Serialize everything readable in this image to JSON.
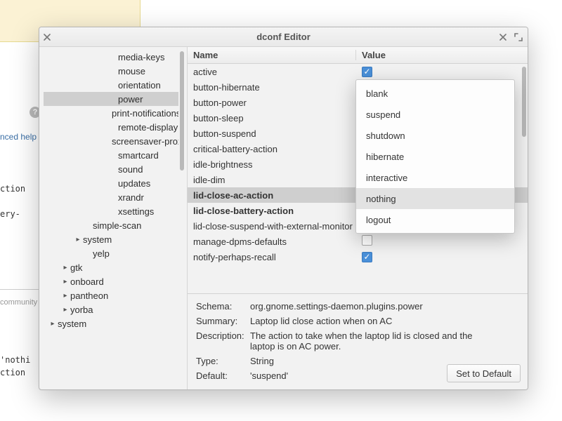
{
  "bg": {
    "link_text": "nced help »",
    "mono1": "ction",
    "mono2": "ery-",
    "mono3": "'nothi",
    "mono4": "ction",
    "community": "community"
  },
  "window": {
    "title": "dconf Editor"
  },
  "tree": [
    {
      "label": "media-keys",
      "indent": 86,
      "expander": false
    },
    {
      "label": "mouse",
      "indent": 86,
      "expander": false
    },
    {
      "label": "orientation",
      "indent": 86,
      "expander": false
    },
    {
      "label": "power",
      "indent": 86,
      "expander": false,
      "selected": true
    },
    {
      "label": "print-notifications",
      "indent": 86,
      "expander": false
    },
    {
      "label": "remote-display",
      "indent": 86,
      "expander": false
    },
    {
      "label": "screensaver-proxy",
      "indent": 86,
      "expander": false
    },
    {
      "label": "smartcard",
      "indent": 86,
      "expander": false
    },
    {
      "label": "sound",
      "indent": 86,
      "expander": false
    },
    {
      "label": "updates",
      "indent": 86,
      "expander": false
    },
    {
      "label": "xrandr",
      "indent": 86,
      "expander": false
    },
    {
      "label": "xsettings",
      "indent": 86,
      "expander": false
    },
    {
      "label": "simple-scan",
      "indent": 50,
      "expander": false
    },
    {
      "label": "system",
      "indent": 36,
      "expander": true
    },
    {
      "label": "yelp",
      "indent": 50,
      "expander": false
    },
    {
      "label": "gtk",
      "indent": 18,
      "expander": true
    },
    {
      "label": "onboard",
      "indent": 18,
      "expander": true
    },
    {
      "label": "pantheon",
      "indent": 18,
      "expander": true
    },
    {
      "label": "yorba",
      "indent": 18,
      "expander": true
    },
    {
      "label": "system",
      "indent": 0,
      "expander": true
    }
  ],
  "table": {
    "header_name": "Name",
    "header_value": "Value",
    "rows": [
      {
        "name": "active",
        "type": "check",
        "checked": true
      },
      {
        "name": "button-hibernate",
        "type": "text",
        "value": ""
      },
      {
        "name": "button-power",
        "type": "text",
        "value": ""
      },
      {
        "name": "button-sleep",
        "type": "text",
        "value": ""
      },
      {
        "name": "button-suspend",
        "type": "text",
        "value": ""
      },
      {
        "name": "critical-battery-action",
        "type": "text",
        "value": ""
      },
      {
        "name": "idle-brightness",
        "type": "text",
        "value": ""
      },
      {
        "name": "idle-dim",
        "type": "text",
        "value": ""
      },
      {
        "name": "lid-close-ac-action",
        "type": "text",
        "value": "",
        "selected": true,
        "bold": true
      },
      {
        "name": "lid-close-battery-action",
        "type": "text",
        "value": "",
        "bold": true
      },
      {
        "name": "lid-close-suspend-with-external-monitor",
        "type": "check",
        "checked": false
      },
      {
        "name": "manage-dpms-defaults",
        "type": "check",
        "checked": false
      },
      {
        "name": "notify-perhaps-recall",
        "type": "check",
        "checked": true
      }
    ]
  },
  "dropdown": {
    "options": [
      "blank",
      "suspend",
      "shutdown",
      "hibernate",
      "interactive",
      "nothing",
      "logout"
    ],
    "hover_index": 5
  },
  "details": {
    "schema_label": "Schema:",
    "schema_value": "org.gnome.settings-daemon.plugins.power",
    "summary_label": "Summary:",
    "summary_value": "Laptop lid close action when on AC",
    "description_label": "Description:",
    "description_value": "The action to take when the laptop lid is closed and the laptop is on AC power.",
    "type_label": "Type:",
    "type_value": "String",
    "default_label": "Default:",
    "default_value": "'suspend'",
    "set_default_button": "Set to Default"
  }
}
